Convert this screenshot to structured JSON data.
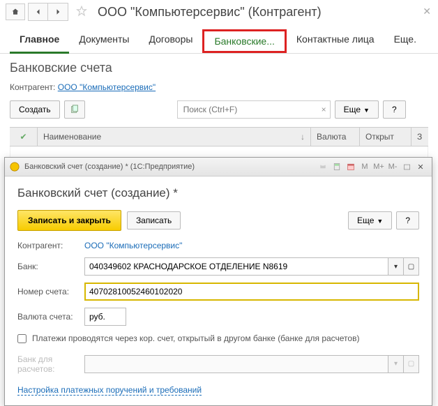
{
  "header": {
    "title": "ООО \"Компьютерсервис\" (Контрагент)"
  },
  "tabs": {
    "main": "Главное",
    "documents": "Документы",
    "contracts": "Договоры",
    "bank": "Банковские...",
    "contacts": "Контактные лица",
    "more": "Еще."
  },
  "subtitle": "Банковские счета",
  "counterparty": {
    "label": "Контрагент:",
    "value": "ООО \"Компьютерсервис\""
  },
  "toolbar": {
    "create": "Создать",
    "search_placeholder": "Поиск (Ctrl+F)",
    "more": "Еще",
    "help": "?"
  },
  "table": {
    "columns": {
      "name": "Наименование",
      "currency": "Валюта",
      "open": "Открыт"
    }
  },
  "dialog": {
    "titlebar": "Банковский счет (создание) * (1С:Предприятие)",
    "tb_icons": {
      "m": "M",
      "mplus": "M+",
      "mminus": "M-"
    },
    "title": "Банковский счет (создание) *",
    "actions": {
      "save_close": "Записать и закрыть",
      "save": "Записать",
      "more": "Еще",
      "help": "?"
    },
    "form": {
      "counterparty_label": "Контрагент:",
      "counterparty_value": "ООО \"Компьютерсервис\"",
      "bank_label": "Банк:",
      "bank_value": "040349602 КРАСНОДАРСКОЕ ОТДЕЛЕНИЕ N8619",
      "account_label": "Номер счета:",
      "account_value": "40702810052460102020",
      "currency_label": "Валюта счета:",
      "currency_value": "руб.",
      "checkbox_label": "Платежи проводятся через кор. счет, открытый в другом банке (банке для расчетов)",
      "settlement_bank_label": "Банк для расчетов:",
      "settings_link": "Настройка платежных поручений и требований"
    }
  }
}
